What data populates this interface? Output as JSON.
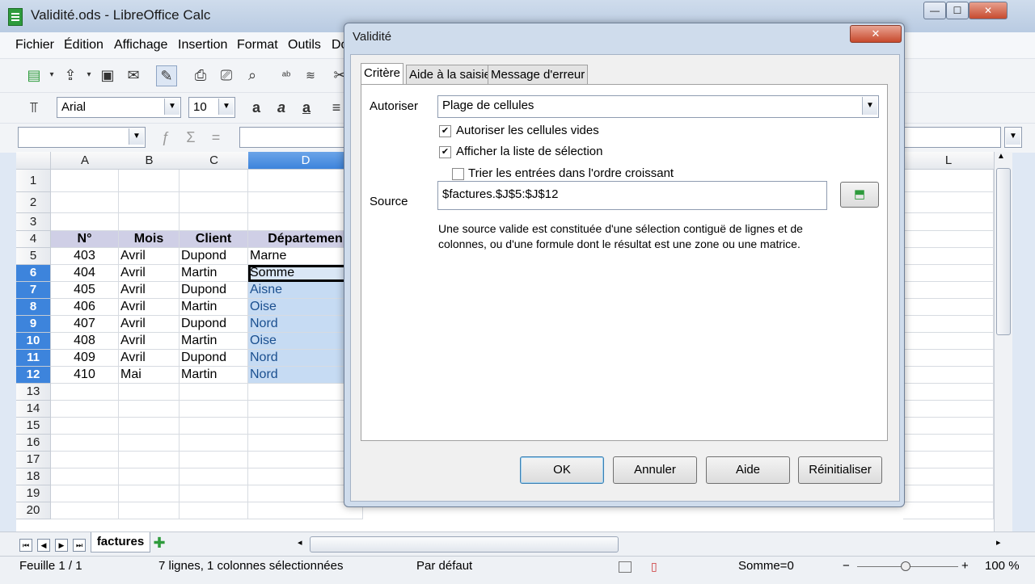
{
  "window": {
    "title": "Validité.ods - LibreOffice Calc"
  },
  "menu": [
    "Fichier",
    "Édition",
    "Affichage",
    "Insertion",
    "Format",
    "Outils",
    "Do"
  ],
  "toolbar": {
    "font_name": "Arial",
    "font_size": "10"
  },
  "grid": {
    "columns": [
      "A",
      "B",
      "C",
      "D",
      "L"
    ],
    "rows": [
      "1",
      "2",
      "3",
      "4",
      "5",
      "6",
      "7",
      "8",
      "9",
      "10",
      "11",
      "12",
      "13",
      "14",
      "15",
      "16",
      "17",
      "18",
      "19",
      "20"
    ],
    "header_row": [
      "N°",
      "Mois",
      "Client",
      "Départemen"
    ],
    "data": [
      [
        "403",
        "Avril",
        "Dupond",
        "Marne"
      ],
      [
        "404",
        "Avril",
        "Martin",
        "Somme"
      ],
      [
        "405",
        "Avril",
        "Dupond",
        "Aisne"
      ],
      [
        "406",
        "Avril",
        "Martin",
        "Oise"
      ],
      [
        "407",
        "Avril",
        "Dupond",
        "Nord"
      ],
      [
        "408",
        "Avril",
        "Martin",
        "Oise"
      ],
      [
        "409",
        "Avril",
        "Dupond",
        "Nord"
      ],
      [
        "410",
        "Mai",
        "Martin",
        "Nord"
      ]
    ]
  },
  "sheet_tab": "factures",
  "status": {
    "sheet": "Feuille 1 / 1",
    "selection": "7 lignes, 1 colonnes sélectionnées",
    "style": "Par défaut",
    "sum": "Somme=0",
    "zoom": "100 %"
  },
  "dialog": {
    "title": "Validité",
    "tabs": [
      "Critère",
      "Aide à la saisie",
      "Message d'erreur"
    ],
    "allow_label": "Autoriser",
    "allow_value": "Plage de cellules",
    "chk_empty": "Autoriser les cellules vides",
    "chk_list": "Afficher la liste de sélection",
    "chk_sort": "Trier les entrées dans l'ordre croissant",
    "chk_empty_checked": true,
    "chk_list_checked": true,
    "chk_sort_checked": false,
    "source_label": "Source",
    "source_value": "$factures.$J$5:$J$12",
    "hint_line1": "Une source valide est constituée d'une sélection contiguë de lignes et de",
    "hint_line2": "colonnes, ou d'une formule dont le résultat est une zone ou une matrice.",
    "buttons": {
      "ok": "OK",
      "cancel": "Annuler",
      "help": "Aide",
      "reset": "Réinitialiser"
    }
  }
}
